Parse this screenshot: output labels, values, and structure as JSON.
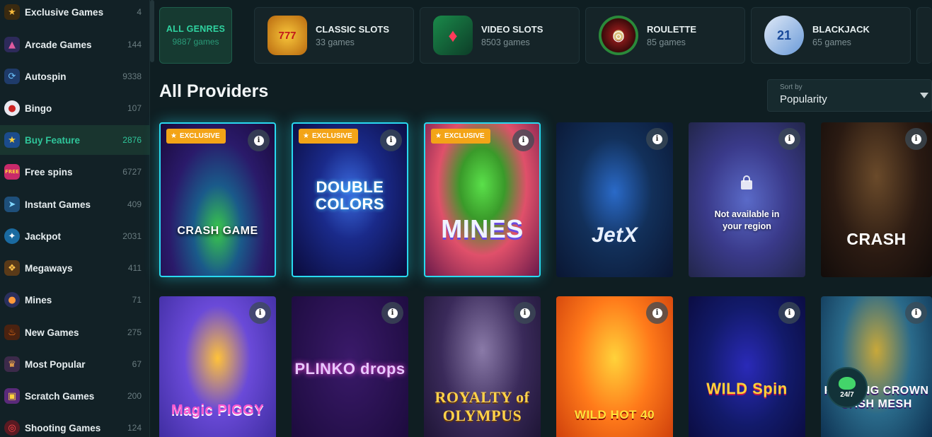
{
  "sidebar": {
    "items": [
      {
        "label": "Exclusive Games",
        "count": "4",
        "icon": "star-crown-icon"
      },
      {
        "label": "Arcade Games",
        "count": "144",
        "icon": "arcade-icon"
      },
      {
        "label": "Autospin",
        "count": "9338",
        "icon": "autospin-icon"
      },
      {
        "label": "Bingo",
        "count": "107",
        "icon": "bingo-ball-icon"
      },
      {
        "label": "Buy Feature",
        "count": "2876",
        "icon": "star-icon"
      },
      {
        "label": "Free spins",
        "count": "6727",
        "icon": "free-badge-icon"
      },
      {
        "label": "Instant Games",
        "count": "409",
        "icon": "lightning-icon"
      },
      {
        "label": "Jackpot",
        "count": "2031",
        "icon": "jackpot-chip-icon"
      },
      {
        "label": "Megaways",
        "count": "411",
        "icon": "megaways-icon"
      },
      {
        "label": "Mines",
        "count": "71",
        "icon": "bomb-icon"
      },
      {
        "label": "New Games",
        "count": "275",
        "icon": "flame-icon"
      },
      {
        "label": "Most Popular",
        "count": "67",
        "icon": "crown-icon"
      },
      {
        "label": "Scratch Games",
        "count": "200",
        "icon": "scratch-card-icon"
      },
      {
        "label": "Shooting Games",
        "count": "124",
        "icon": "target-icon"
      }
    ],
    "active_label": "Buy Feature"
  },
  "genres": {
    "all": {
      "title": "ALL GENRES",
      "count": "9887 games"
    },
    "items": [
      {
        "name": "CLASSIC SLOTS",
        "count": "33 games",
        "icon": "777-slot-icon",
        "glyph": "777"
      },
      {
        "name": "VIDEO SLOTS",
        "count": "8503 games",
        "icon": "video-slot-icon",
        "glyph": "♦"
      },
      {
        "name": "ROULETTE",
        "count": "85 games",
        "icon": "roulette-wheel-icon",
        "glyph": "◎"
      },
      {
        "name": "BLACKJACK",
        "count": "65 games",
        "icon": "cards-21-icon",
        "glyph": "21"
      }
    ]
  },
  "main": {
    "heading": "All Providers",
    "sort": {
      "label": "Sort by",
      "value": "Popularity"
    }
  },
  "badges": {
    "exclusive": "EXCLUSIVE"
  },
  "unavailable_text": {
    "line1": "Not available in",
    "line2": "your region"
  },
  "games": [
    {
      "title": "CRASH GAME",
      "exclusive": true
    },
    {
      "title": "DOUBLE COLORS",
      "exclusive": true
    },
    {
      "title": "MINES",
      "exclusive": true
    },
    {
      "title": "JetX",
      "exclusive": false
    },
    {
      "title": "",
      "exclusive": false,
      "unavailable": true
    },
    {
      "title": "CRASH",
      "exclusive": false
    },
    {
      "title": "Magic PIGGY",
      "exclusive": false
    },
    {
      "title": "PLINKO drops",
      "exclusive": false
    },
    {
      "title": "ROYALTY of OLYMPUS",
      "exclusive": false
    },
    {
      "title": "WILD HOT 40",
      "exclusive": false
    },
    {
      "title": "WILD Spin",
      "exclusive": false
    },
    {
      "title": "RUNNING CROWN CASH MESH",
      "exclusive": false
    }
  ],
  "support": {
    "text": "24/7"
  },
  "colors": {
    "accent": "#2fd3a0",
    "exclusive_badge": "#f3a417",
    "glow": "#29d9f0",
    "background": "#0f1e22"
  }
}
